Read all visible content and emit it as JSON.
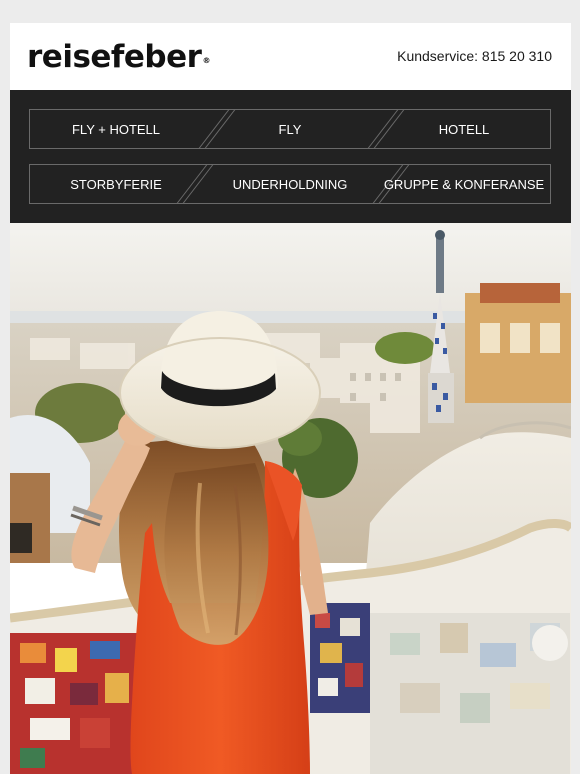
{
  "header": {
    "logo_text": "reisefeber",
    "logo_mark": "®",
    "customer_service": "Kundservice: 815 20 310"
  },
  "nav": {
    "row1": [
      "FLY + HOTELL",
      "FLY",
      "HOTELL"
    ],
    "row2": [
      "STORBYFERIE",
      "UNDERHOLDNING",
      "GRUPPE & KONFERANSE"
    ]
  },
  "hero": {
    "image": "woman-in-hat-overlooking-barcelona-park-guell"
  }
}
